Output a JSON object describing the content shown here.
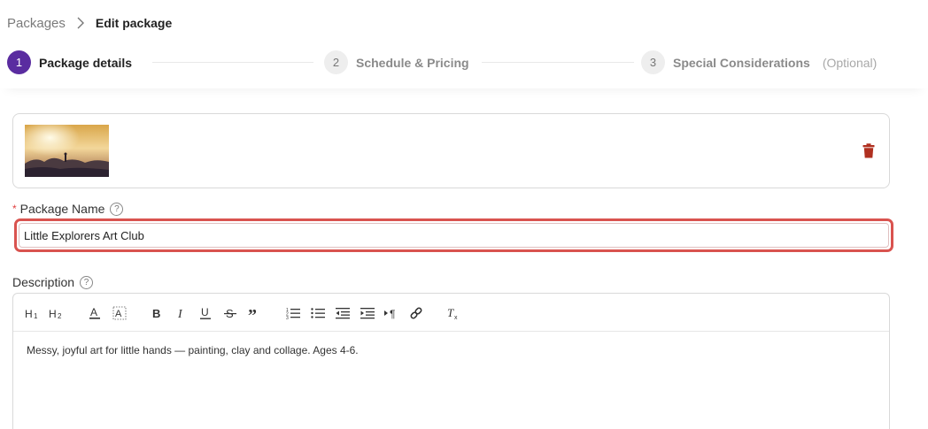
{
  "breadcrumb": {
    "parent": "Packages",
    "current": "Edit package"
  },
  "steps": [
    {
      "number": "1",
      "label": "Package details",
      "active": true
    },
    {
      "number": "2",
      "label": "Schedule & Pricing",
      "active": false
    },
    {
      "number": "3",
      "label": "Special Considerations",
      "optional": "(Optional)",
      "active": false
    }
  ],
  "form": {
    "name_required_mark": "*",
    "name_label": "Package Name",
    "name_value": "Little Explorers Art Club",
    "description_label": "Description",
    "description_text": "Messy, joyful art for little hands — painting, clay and collage. Ages 4-6."
  },
  "toolbar": {
    "items": [
      "h1-icon",
      "h2-icon",
      "font-color-icon",
      "highlight-icon",
      "bold-icon",
      "italic-icon",
      "underline-icon",
      "strikethrough-icon",
      "blockquote-icon",
      "ordered-list-icon",
      "bullet-list-icon",
      "outdent-icon",
      "indent-icon",
      "text-direction-icon",
      "link-icon",
      "clear-format-icon"
    ]
  },
  "colors": {
    "accent": "#5a2ca0",
    "error_outline": "#d9534f",
    "delete": "#b03020"
  }
}
